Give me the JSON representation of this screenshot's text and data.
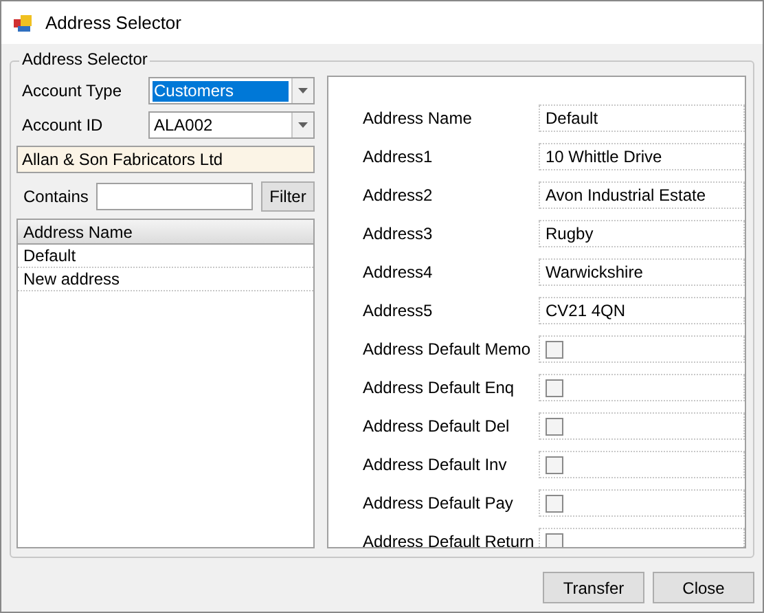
{
  "window": {
    "title": "Address Selector"
  },
  "group": {
    "title": "Address Selector"
  },
  "account_type": {
    "label": "Account Type",
    "value": "Customers"
  },
  "account_id": {
    "label": "Account ID",
    "value": "ALA002"
  },
  "account_name": "Allan & Son Fabricators Ltd",
  "contains": {
    "label": "Contains",
    "button": "Filter"
  },
  "address_list": {
    "column": "Address Name",
    "rows": [
      {
        "name": "Default"
      },
      {
        "name": "New address"
      }
    ]
  },
  "fields": [
    {
      "kind": "text",
      "label": "Address Name",
      "value": "Default"
    },
    {
      "kind": "text",
      "label": "Address1",
      "value": "10 Whittle Drive"
    },
    {
      "kind": "text",
      "label": "Address2",
      "value": "Avon Industrial Estate"
    },
    {
      "kind": "text",
      "label": "Address3",
      "value": "Rugby"
    },
    {
      "kind": "text",
      "label": "Address4",
      "value": "Warwickshire"
    },
    {
      "kind": "text",
      "label": "Address5",
      "value": "CV21 4QN"
    },
    {
      "kind": "check",
      "label": "Address Default Memo",
      "checked": false
    },
    {
      "kind": "check",
      "label": "Address Default Enq",
      "checked": false
    },
    {
      "kind": "check",
      "label": "Address Default Del",
      "checked": false
    },
    {
      "kind": "check",
      "label": "Address Default Inv",
      "checked": false
    },
    {
      "kind": "check",
      "label": "Address Default Pay",
      "checked": false
    },
    {
      "kind": "check",
      "label": "Address Default Return",
      "checked": false
    }
  ],
  "buttons": [
    "Transfer",
    "Close"
  ]
}
